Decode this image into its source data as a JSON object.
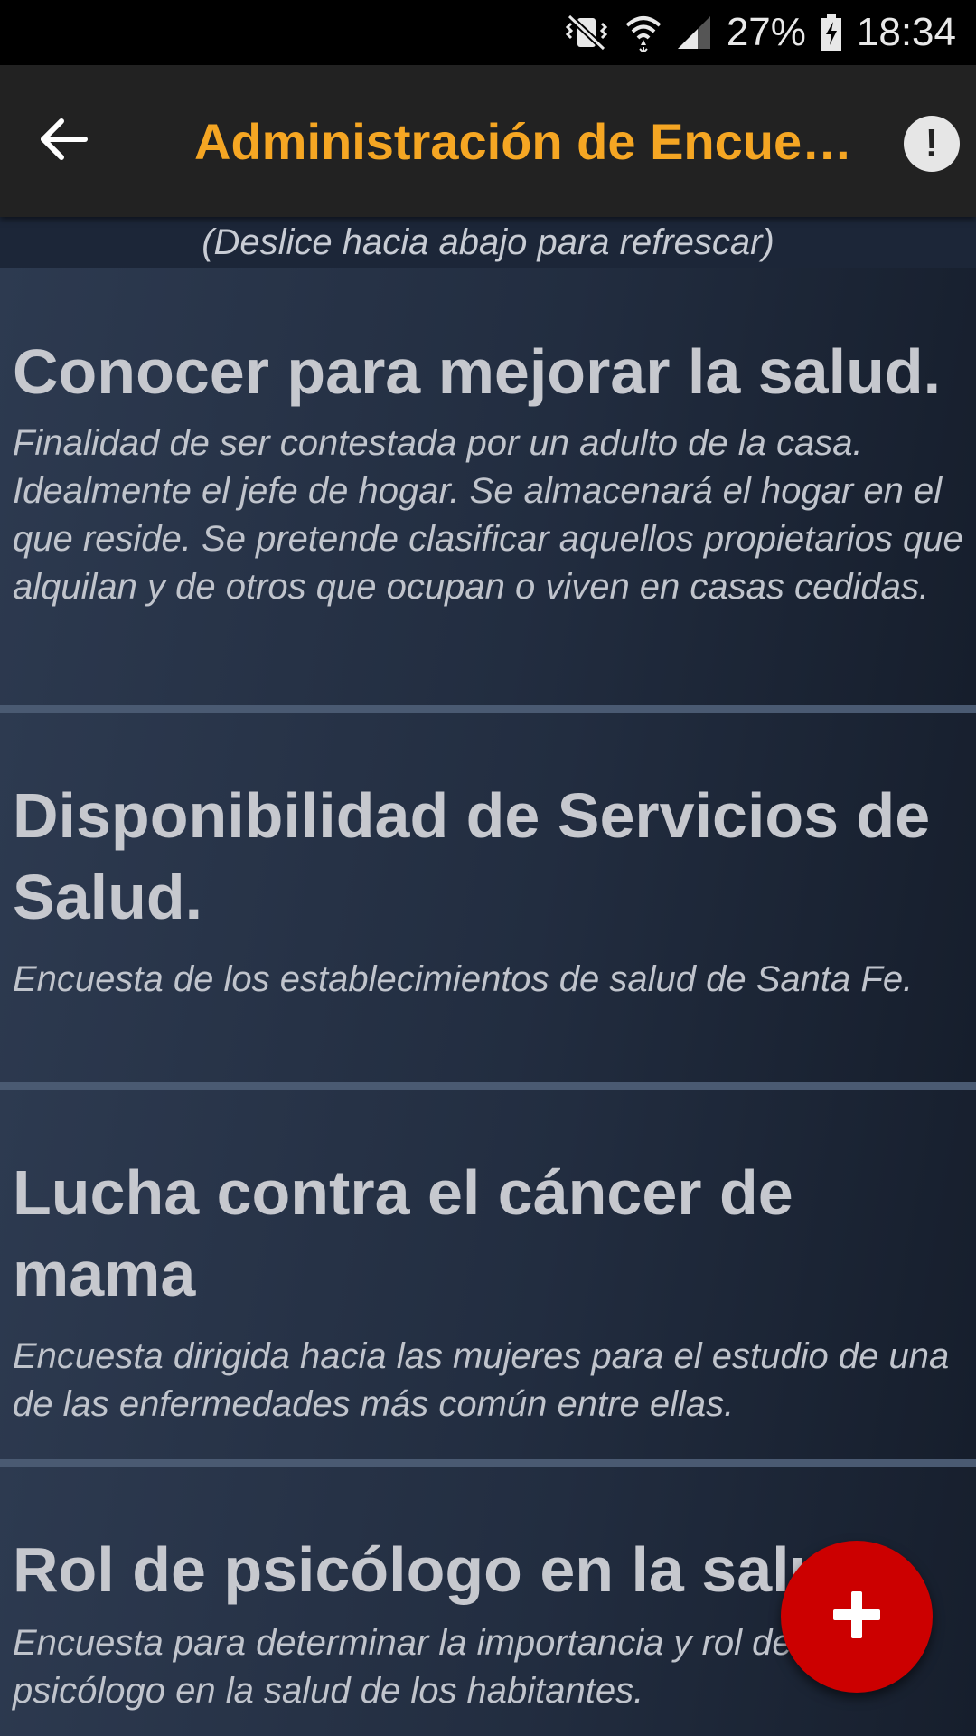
{
  "status_bar": {
    "battery": "27%",
    "time": "18:34",
    "icons": [
      "vibrate-muted-icon",
      "wifi-icon",
      "signal-icon",
      "battery-charging-icon"
    ]
  },
  "app_bar": {
    "title": "Administración de Encuestas",
    "back_icon": "arrow-back-icon",
    "alert_icon": "exclamation-icon",
    "alert_symbol": "!"
  },
  "refresh_hint": "(Deslice hacia abajo para refrescar)",
  "surveys": [
    {
      "title": "Conocer para mejorar la salud.",
      "description": "Finalidad de ser contestada por un adulto de la casa. Idealmente el jefe de hogar. Se almacenará el hogar en el que reside. Se pretende clasificar aquellos propietarios que alquilan y de otros que ocupan o viven en casas cedidas."
    },
    {
      "title": "Disponibilidad de Servicios de Salud.",
      "description": "Encuesta de los establecimientos de salud de Santa Fe."
    },
    {
      "title": "Lucha contra el cáncer de mama",
      "description": "Encuesta dirigida hacia las mujeres para el estudio de una de las enfermedades más común entre ellas."
    },
    {
      "title": "Rol de psicólogo en la salud",
      "description_line1": "Encuesta para determinar la importancia y rol del",
      "description_line2": "psicólogo en la salud de los habitantes."
    }
  ],
  "fab": {
    "icon": "plus-icon"
  },
  "colors": {
    "status_bar": "#000000",
    "app_bar": "#222222",
    "title_accent": "#f5a623",
    "card_divider": "#4a5a72",
    "fab": "#cc0000"
  }
}
